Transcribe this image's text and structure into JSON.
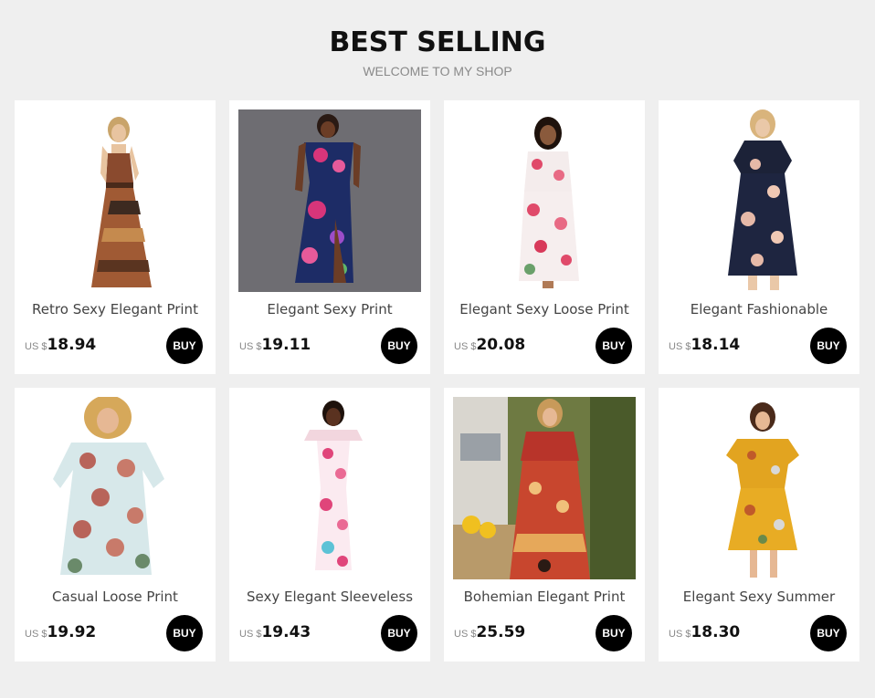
{
  "header": {
    "title": "BEST SELLING",
    "subtitle": "WELCOME TO MY SHOP"
  },
  "products": [
    {
      "name": "Retro Sexy Elegant Print",
      "currency": "US $",
      "price": "18.94",
      "buy_label": "BUY",
      "image": "model-halter-tribal-maxi-dress-photo"
    },
    {
      "name": "Elegant Sexy Print",
      "currency": "US $",
      "price": "19.11",
      "buy_label": "BUY",
      "image": "model-navy-floral-split-maxi-photo"
    },
    {
      "name": "Elegant Sexy Loose Print",
      "currency": "US $",
      "price": "20.08",
      "buy_label": "BUY",
      "image": "model-white-floral-maxi-photo"
    },
    {
      "name": "Elegant Fashionable",
      "currency": "US $",
      "price": "18.14",
      "buy_label": "BUY",
      "image": "model-navy-cold-shoulder-floral-dress-photo"
    },
    {
      "name": "Casual Loose Print",
      "currency": "US $",
      "price": "19.92",
      "buy_label": "BUY",
      "image": "model-light-blue-floral-maxi-photo"
    },
    {
      "name": "Sexy Elegant Sleeveless",
      "currency": "US $",
      "price": "19.43",
      "buy_label": "BUY",
      "image": "model-white-floral-ruffle-maxi-photo"
    },
    {
      "name": "Bohemian Elegant Print",
      "currency": "US $",
      "price": "25.59",
      "buy_label": "BUY",
      "image": "model-bohemian-red-maxi-outdoor-photo"
    },
    {
      "name": "Elegant Sexy Summer",
      "currency": "US $",
      "price": "18.30",
      "buy_label": "BUY",
      "image": "model-yellow-floral-short-dress-photo"
    }
  ],
  "colors": {
    "background": "#efefef",
    "card": "#ffffff",
    "buy_button": "#000000"
  }
}
